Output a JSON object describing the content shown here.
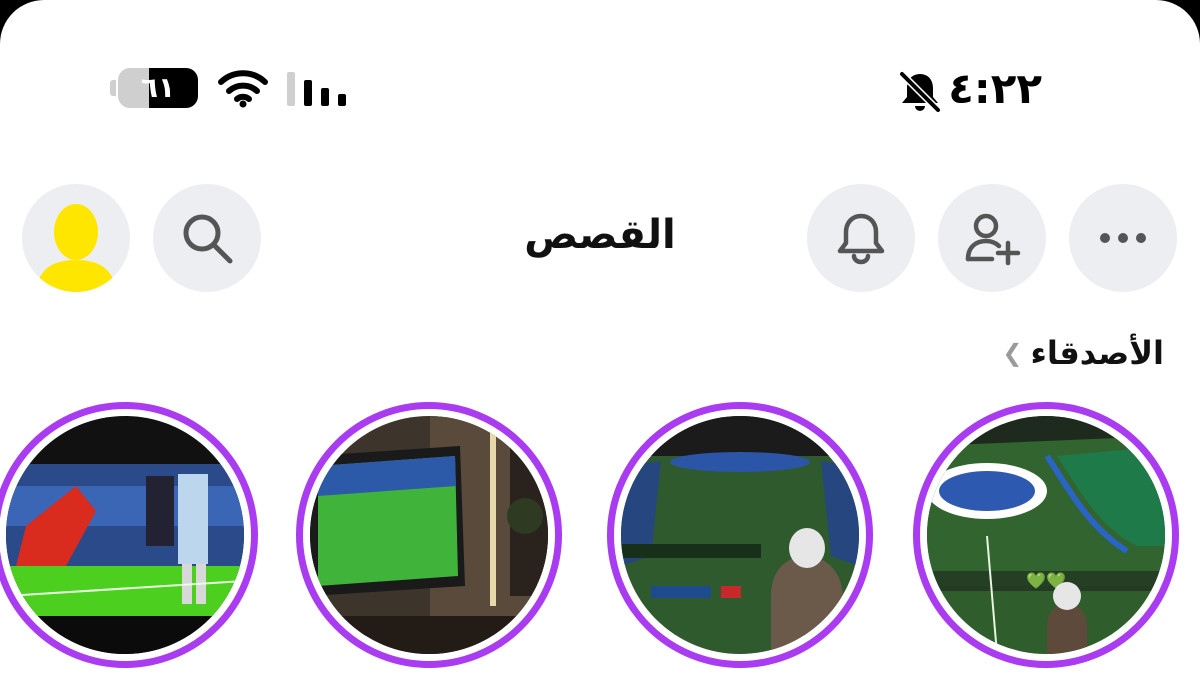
{
  "status_bar": {
    "time": "٤:٢٢",
    "battery_level": "٦١",
    "battery_fraction": 0.61
  },
  "header": {
    "title": "القصص"
  },
  "friends_section": {
    "label": "الأصدقاء"
  },
  "stories": [
    {
      "id": "story-1",
      "thumbnail": "football-match-tv-screen"
    },
    {
      "id": "story-2",
      "thumbnail": "tv-on-wall-match"
    },
    {
      "id": "story-3",
      "thumbnail": "stadium-with-spectator"
    },
    {
      "id": "story-4",
      "thumbnail": "stadium-pitch-ceremony"
    }
  ],
  "story4_overlay": "💚💚",
  "colors": {
    "story_ring": "#a93bf0",
    "button_bg": "#eceef1",
    "avatar": "#ffe600"
  }
}
